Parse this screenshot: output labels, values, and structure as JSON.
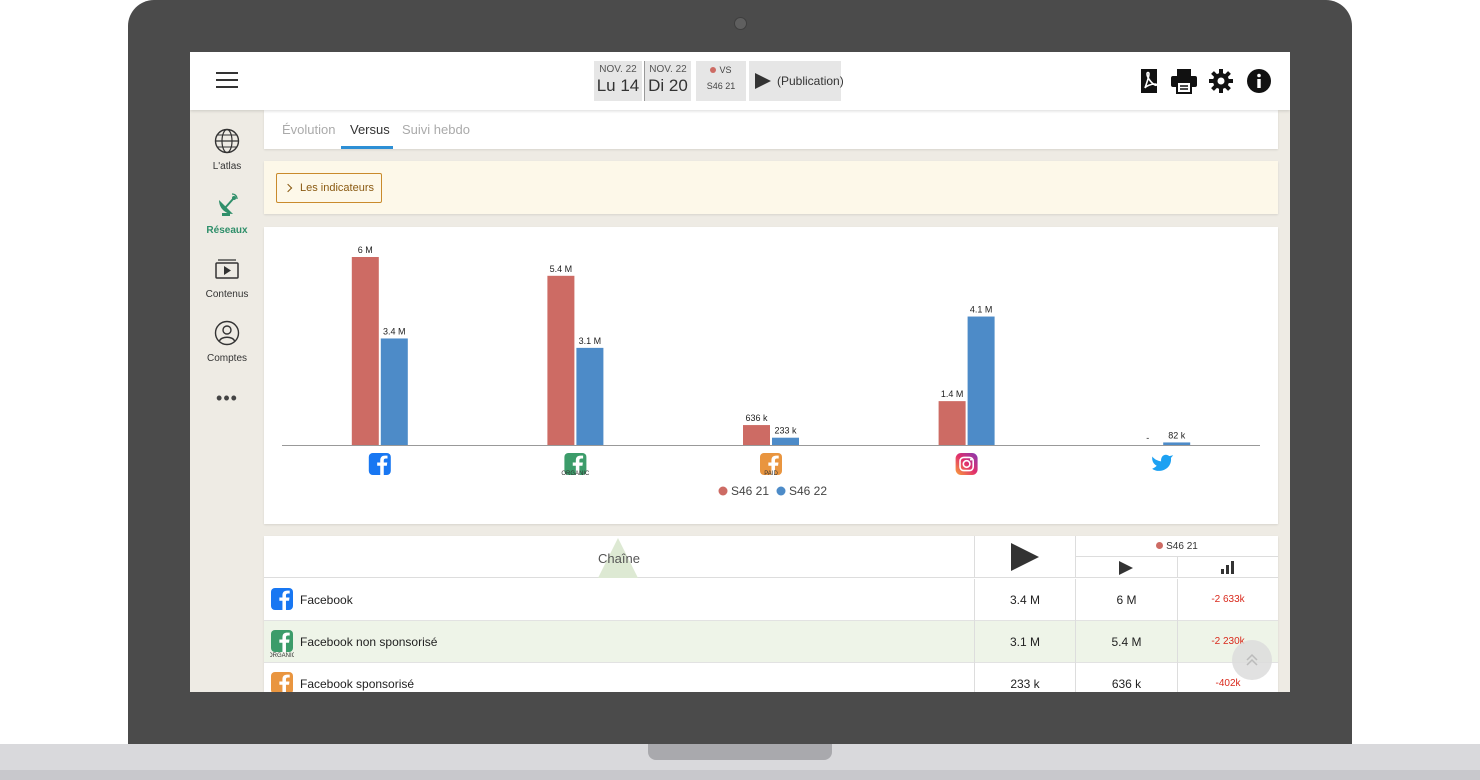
{
  "header": {
    "date_from": {
      "month": "NOV. 22",
      "day": "Lu 14"
    },
    "date_to": {
      "month": "NOV. 22",
      "day": "Di 20"
    },
    "vs": {
      "label": "VS",
      "period": "S46 21"
    },
    "metric_label": "(Publication)"
  },
  "sidebar": {
    "items": [
      {
        "label": "L'atlas"
      },
      {
        "label": "Réseaux"
      },
      {
        "label": "Contenus"
      },
      {
        "label": "Comptes"
      }
    ],
    "more": "•••"
  },
  "tabs": [
    "Évolution",
    "Versus",
    "Suivi hebdo"
  ],
  "active_tab": "Versus",
  "indicators_button": "Les indicateurs",
  "colors": {
    "series_a": "#cd6b64",
    "series_b": "#4d8bc8",
    "accent": "#2d8fd5"
  },
  "chart_data": {
    "type": "bar",
    "categories": [
      "Facebook",
      "Facebook non sponsorisé",
      "Facebook sponsorisé",
      "Instagram",
      "Twitter"
    ],
    "category_icons": [
      "facebook-icon",
      "facebook-organic-icon",
      "facebook-paid-icon",
      "instagram-icon",
      "twitter-icon"
    ],
    "icon_captions": [
      "",
      "ORGANIC",
      "PAID",
      "",
      ""
    ],
    "series": [
      {
        "name": "S46 21",
        "values": [
          6000000,
          5400000,
          636000,
          1400000,
          0
        ],
        "labels": [
          "6 M",
          "5.4 M",
          "636 k",
          "1.4 M",
          "-"
        ]
      },
      {
        "name": "S46 22",
        "values": [
          3400000,
          3100000,
          233000,
          4100000,
          82000
        ],
        "labels": [
          "3.4 M",
          "3.1 M",
          "233 k",
          "4.1 M",
          "82 k"
        ]
      }
    ],
    "ylim": [
      0,
      6000000
    ],
    "legend_position": "bottom"
  },
  "table": {
    "header": {
      "channel": "Chaîne",
      "period": "S46 21"
    },
    "rows": [
      {
        "name": "Facebook",
        "caption": "",
        "current": "3.4 M",
        "previous": "6 M",
        "diff": "-2 633k"
      },
      {
        "name": "Facebook non sponsorisé",
        "caption": "ORGANIC",
        "current": "3.1 M",
        "previous": "5.4 M",
        "diff": "-2 230k"
      },
      {
        "name": "Facebook sponsorisé",
        "caption": "PAID",
        "current": "233 k",
        "previous": "636 k",
        "diff": "-402k"
      }
    ]
  }
}
